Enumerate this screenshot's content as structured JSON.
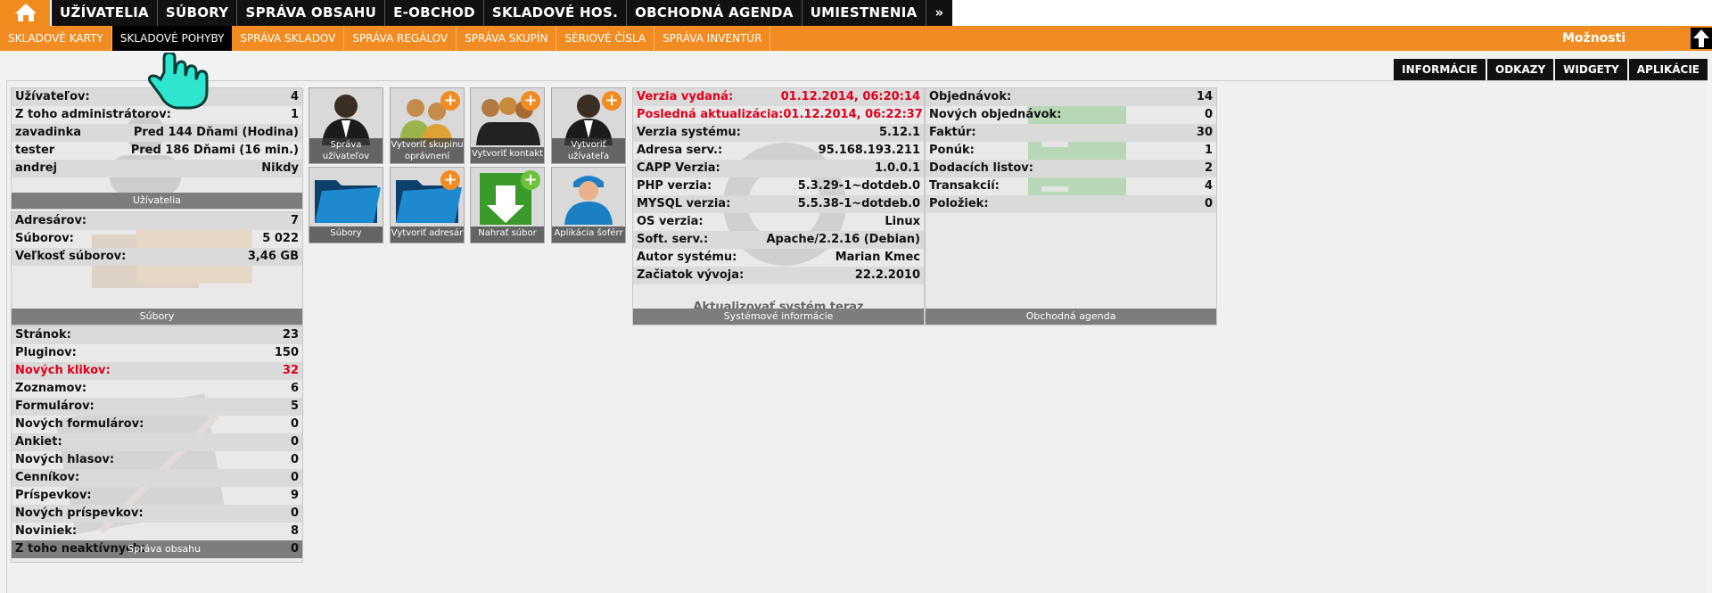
{
  "nav": {
    "home_icon": "home-icon",
    "items": [
      "UŽÍVATELIA",
      "SÚBORY",
      "SPRÁVA OBSAHU",
      "E-OBCHOD",
      "SKLADOVÉ HOS.",
      "OBCHODNÁ AGENDA",
      "UMIESTNENIA"
    ],
    "more": "»"
  },
  "subnav": {
    "items": [
      "SKLADOVÉ KARTY",
      "SKLADOVÉ POHYBY",
      "SPRÁVA SKLADOV",
      "SPRÁVA REGÁLOV",
      "SPRÁVA SKUPÍN",
      "SÉRIOVÉ ČÍSLA",
      "SPRÁVA INVENTÚR"
    ],
    "active_index": 1,
    "options": "Možnosti",
    "scroll_up_icon": "arrow-up-icon"
  },
  "right_tabs": [
    "INFORMÁCIE",
    "ODKAZY",
    "WIDGETY",
    "APLIKÁCIE"
  ],
  "users_panel": {
    "rows": [
      {
        "k": "Užívateľov:",
        "v": "4"
      },
      {
        "k": "Z toho administrátorov:",
        "v": "1"
      },
      {
        "k": "zavadinka",
        "v": "Pred 144 Dňami (Hodina)"
      },
      {
        "k": "tester",
        "v": "Pred 186 Dňami (16 min.)"
      },
      {
        "k": "andrej",
        "v": "Nikdy"
      }
    ],
    "footer": "Užívatelia"
  },
  "files_panel": {
    "rows": [
      {
        "k": "Adresárov:",
        "v": "7"
      },
      {
        "k": "Súborov:",
        "v": "5 022"
      },
      {
        "k": "Veľkosť súborov:",
        "v": "3,46 GB"
      }
    ],
    "footer": "Súbory"
  },
  "content_panel": {
    "rows": [
      {
        "k": "Stránok:",
        "v": "23"
      },
      {
        "k": "Pluginov:",
        "v": "150"
      },
      {
        "k": "Nových klikov:",
        "v": "32"
      },
      {
        "k": "Zoznamov:",
        "v": "6"
      },
      {
        "k": "Formulárov:",
        "v": "5"
      },
      {
        "k": "Nových formulárov:",
        "v": "0"
      },
      {
        "k": "Ankiet:",
        "v": "0"
      },
      {
        "k": "Nových hlasov:",
        "v": "0"
      },
      {
        "k": "Cenníkov:",
        "v": "0"
      },
      {
        "k": "Príspevkov:",
        "v": "9"
      },
      {
        "k": "Nových príspevkov:",
        "v": "0"
      },
      {
        "k": "Noviniek:",
        "v": "8"
      },
      {
        "k": "Z toho neaktívnych:",
        "v": "0"
      }
    ],
    "footer": "Správa obsahu"
  },
  "apps": [
    {
      "label": "Správa užívateľov",
      "icon": "user-admin-icon"
    },
    {
      "label": "Vytvoriť skupinu oprávnení",
      "icon": "add-group-icon"
    },
    {
      "label": "Vytvoriť kontakt",
      "icon": "add-contact-icon"
    },
    {
      "label": "Vytvoriť užívateľa",
      "icon": "add-user-icon"
    },
    {
      "label": "Súbory",
      "icon": "folder-icon"
    },
    {
      "label": "Vytvoriť adresár",
      "icon": "add-folder-icon"
    },
    {
      "label": "Nahrať súbor",
      "icon": "upload-file-icon"
    },
    {
      "label": "Aplikácia šoférr",
      "icon": "driver-app-icon"
    }
  ],
  "system_panel": {
    "rows": [
      {
        "k": "Verzia vydaná:",
        "v": "01.12.2014, 06:20:14",
        "red": true
      },
      {
        "k": "Posledná aktualizácia:",
        "v": "01.12.2014, 06:22:37",
        "red": true
      },
      {
        "k": "Verzia systému:",
        "v": "5.12.1"
      },
      {
        "k": "Adresa serv.:",
        "v": "95.168.193.211"
      },
      {
        "k": "CAPP Verzia:",
        "v": "1.0.0.1"
      },
      {
        "k": "PHP verzia:",
        "v": "5.3.29-1~dotdeb.0"
      },
      {
        "k": "MYSQL verzia:",
        "v": "5.5.38-1~dotdeb.0"
      },
      {
        "k": "OS verzia:",
        "v": "Linux"
      },
      {
        "k": "Soft. serv.:",
        "v": "Apache/2.2.16 (Debian)"
      },
      {
        "k": "Autor systému:",
        "v": "Marian Kmec"
      },
      {
        "k": "Začiatok vývoja:",
        "v": "22.2.2010"
      }
    ],
    "update_link": "Aktualizovať systém teraz",
    "footer": "Systémové informácie"
  },
  "business_panel": {
    "rows": [
      {
        "k": "Objednávok:",
        "v": "14"
      },
      {
        "k": "Nových objednávok:",
        "v": "0"
      },
      {
        "k": "Faktúr:",
        "v": "30"
      },
      {
        "k": "Ponúk:",
        "v": "1"
      },
      {
        "k": "Dodacích listov:",
        "v": "2"
      },
      {
        "k": "Transakcií:",
        "v": "4"
      },
      {
        "k": "Položiek:",
        "v": "0"
      }
    ],
    "footer": "Obchodná agenda"
  },
  "colors": {
    "accent": "#f28c22",
    "nav_bg": "#111111",
    "alert": "#e0001b"
  }
}
